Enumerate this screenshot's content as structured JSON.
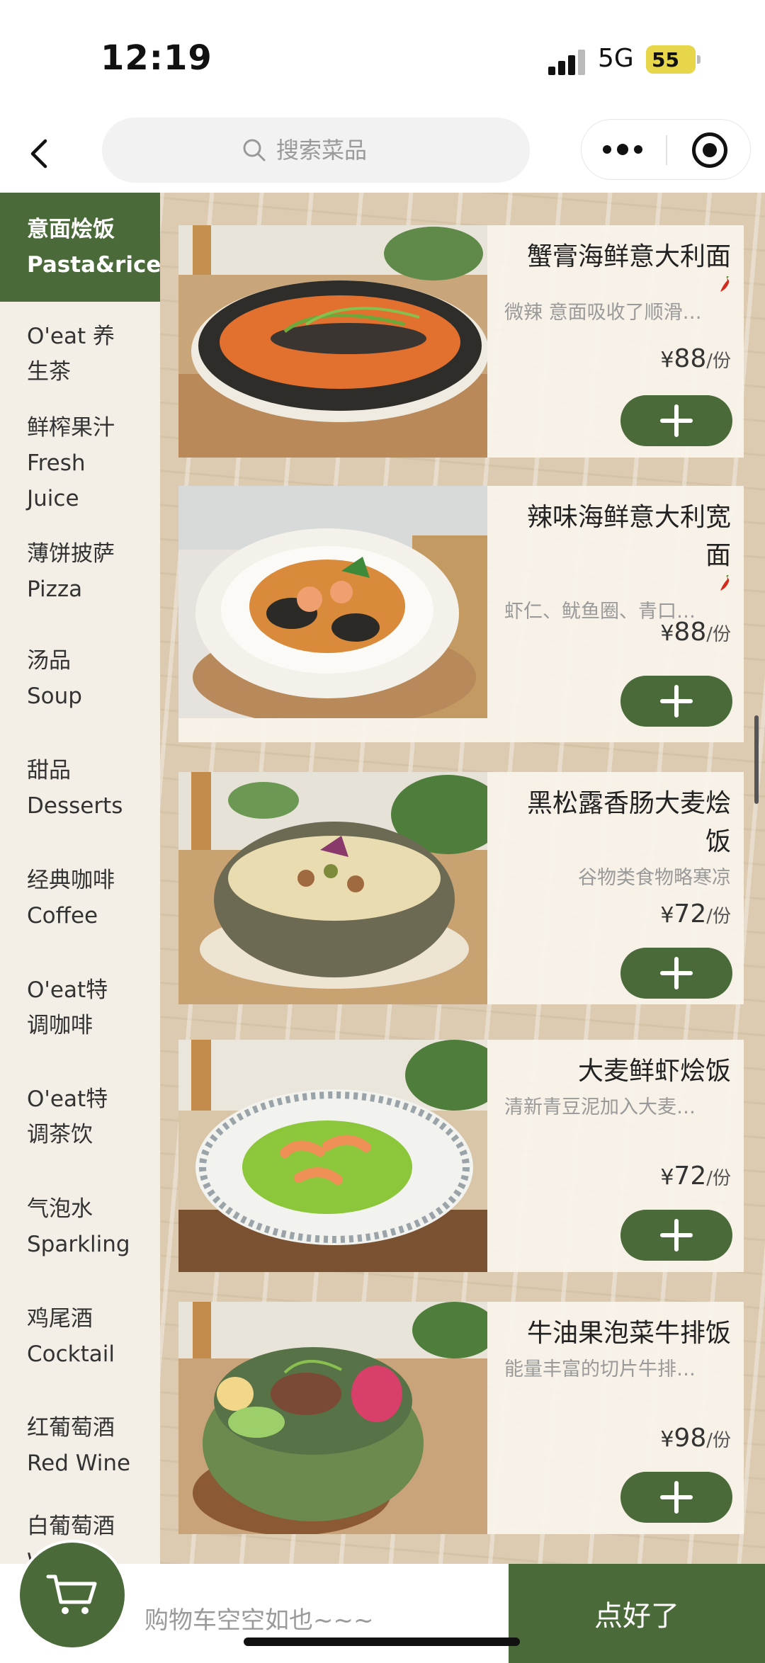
{
  "status_bar": {
    "time": "12:19",
    "network": "5G",
    "battery": "55"
  },
  "nav": {
    "search_placeholder": "搜索菜品"
  },
  "sidebar": {
    "items": [
      {
        "line1": "意面烩饭",
        "line2": "Pasta&rice",
        "active": true
      },
      {
        "line1": "O'eat 养",
        "line2": "生茶"
      },
      {
        "line1": "鲜榨果汁",
        "line2": "Fresh",
        "line3": "Juice"
      },
      {
        "line1": "薄饼披萨",
        "line2": "Pizza"
      },
      {
        "line1": "汤品",
        "line2": "Soup"
      },
      {
        "line1": "甜品",
        "line2": "Desserts"
      },
      {
        "line1": "经典咖啡",
        "line2": "Coffee"
      },
      {
        "line1": "O'eat特",
        "line2": "调咖啡"
      },
      {
        "line1": "O'eat特",
        "line2": "调茶饮"
      },
      {
        "line1": "气泡水",
        "line2": "Sparkling"
      },
      {
        "line1": "鸡尾酒",
        "line2": "Cocktail"
      },
      {
        "line1": "红葡萄酒",
        "line2": "Red Wine"
      },
      {
        "line1": "白葡萄酒",
        "line2": "W"
      }
    ]
  },
  "dishes": [
    {
      "name": "蟹膏海鲜意大利面",
      "spicy": true,
      "desc": "微辣 意面吸收了顺滑…",
      "currency": "¥",
      "price": "88",
      "unit": "/份"
    },
    {
      "name": "辣味海鲜意大利宽面",
      "spicy": true,
      "desc": "虾仁、鱿鱼圈、青口…",
      "currency": "¥",
      "price": "88",
      "unit": "/份"
    },
    {
      "name": "黑松露香肠大麦烩饭",
      "spicy": false,
      "desc": "谷物类食物略寒凉",
      "currency": "¥",
      "price": "72",
      "unit": "/份"
    },
    {
      "name": "大麦鲜虾烩饭",
      "spicy": false,
      "desc": "清新青豆泥加入大麦…",
      "currency": "¥",
      "price": "72",
      "unit": "/份"
    },
    {
      "name": "牛油果泡菜牛排饭",
      "spicy": false,
      "desc": "能量丰富的切片牛排…",
      "currency": "¥",
      "price": "98",
      "unit": "/份"
    }
  ],
  "cart": {
    "empty_text": "购物车空空如也~~~",
    "checkout_label": "点好了"
  },
  "colors": {
    "accent": "#4b6a3a",
    "sidebar_bg": "#f4efe6",
    "chili": "#d22b1e"
  }
}
